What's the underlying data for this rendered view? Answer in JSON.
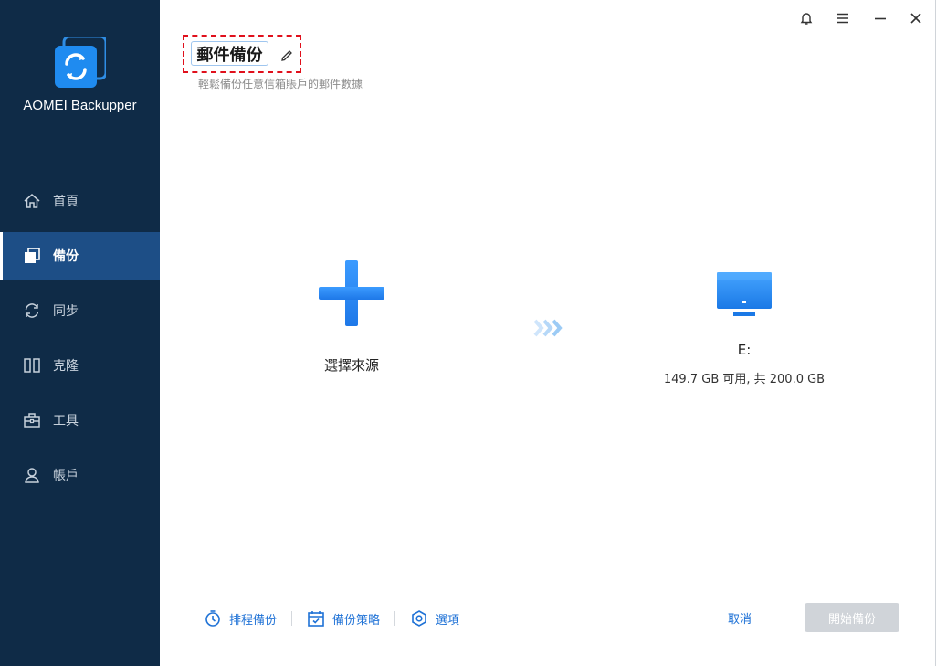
{
  "app": {
    "name": "AOMEI Backupper"
  },
  "sidebar": {
    "items": [
      {
        "label": "首頁",
        "icon": "home-icon"
      },
      {
        "label": "備份",
        "icon": "backup-icon",
        "active": true
      },
      {
        "label": "同步",
        "icon": "sync-icon"
      },
      {
        "label": "克隆",
        "icon": "clone-icon"
      },
      {
        "label": "工具",
        "icon": "toolbox-icon"
      },
      {
        "label": "帳戶",
        "icon": "user-icon"
      }
    ]
  },
  "window_controls": [
    "bell-icon",
    "menu-icon",
    "minimize-icon",
    "close-icon"
  ],
  "task": {
    "title": "郵件備份",
    "subtitle": "輕鬆備份任意信箱賬戶的郵件數據"
  },
  "source": {
    "label": "選擇來源"
  },
  "destination": {
    "label": "E:",
    "space": "149.7 GB 可用, 共 200.0 GB"
  },
  "footer": {
    "schedule": "排程備份",
    "scheme": "備份策略",
    "options": "選項",
    "cancel": "取消",
    "start": "開始備份"
  },
  "colors": {
    "sidebar_bg": "#0f2b47",
    "sidebar_active": "#1d4e86",
    "accent": "#1f72d6",
    "highlight_border": "#e0101c",
    "disabled_button": "#d0d4d9"
  }
}
